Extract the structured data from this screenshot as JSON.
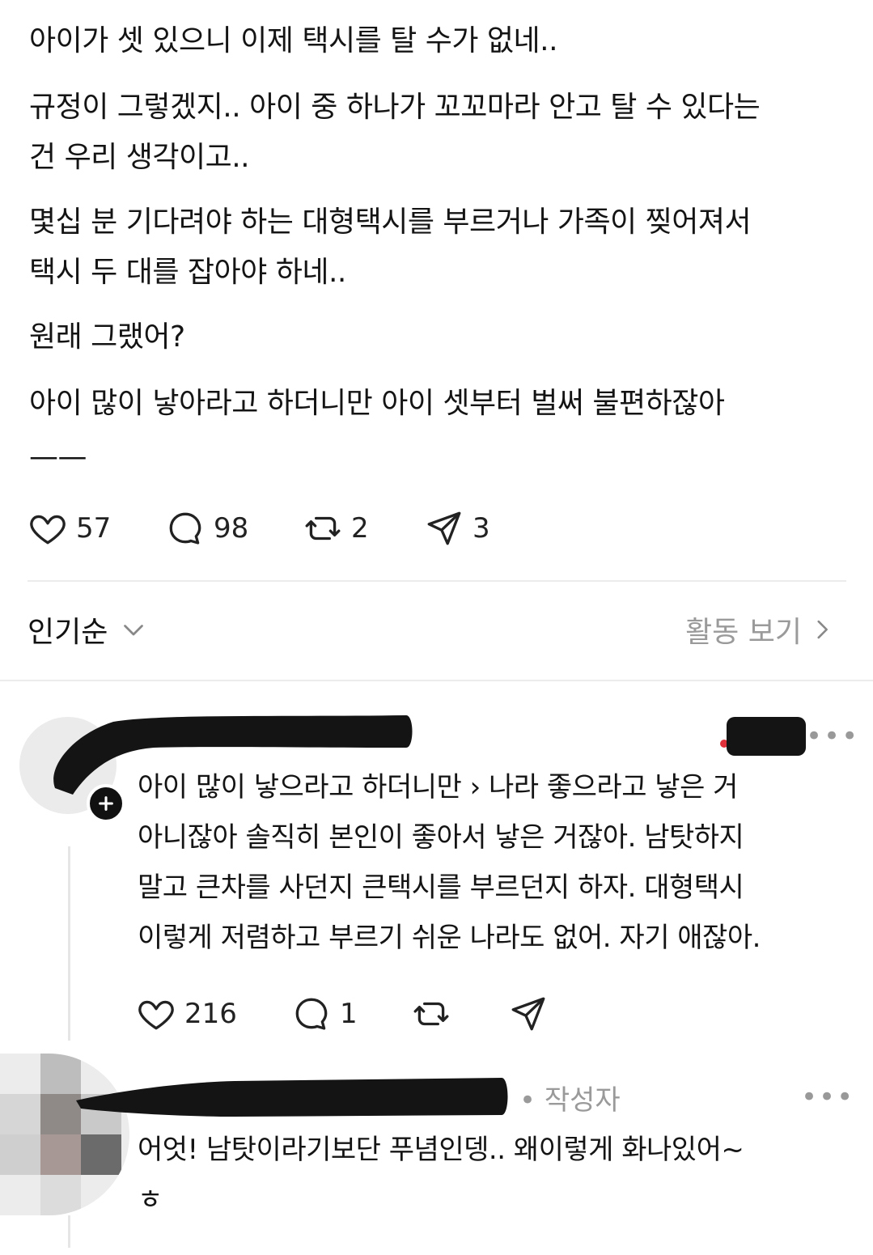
{
  "post": {
    "paragraphs": [
      [
        "아이가 셋 있으니 이제 택시를 탈 수가 없네.."
      ],
      [
        "규정이 그렇겠지.. 아이 중 하나가 꼬꼬마라 안고 탈 수 있다는",
        "건 우리 생각이고.."
      ],
      [
        "몇십 분 기다려야 하는 대형택시를 부르거나 가족이 찢어져서",
        "택시 두 대를 잡아야 하네.."
      ],
      [
        "원래 그랬어?"
      ],
      [
        "아이 많이 낳아라고 하더니만 아이 셋부터 벌써 불편하잖아"
      ],
      [
        "——"
      ]
    ],
    "actions": {
      "likes": "57",
      "comments": "98",
      "reposts": "2",
      "shares": "3"
    }
  },
  "sort": {
    "label": "인기순",
    "activity_label": "활동 보기"
  },
  "comments": [
    {
      "lines": [
        "아이 많이 낳으라고 하더니만 › 나라 좋으라고 낳은 거",
        "아니잖아 솔직히 본인이 좋아서 낳은 거잖아. 남탓하지",
        "말고 큰차를 사던지 큰택시를 부르던지 하자. 대형택시",
        "이렇게 저렴하고 부르기 쉬운 나라도 없어. 자기 애잖아."
      ],
      "likes": "216",
      "replies": "1",
      "more": "•••"
    },
    {
      "author_badge": "• 작성자",
      "lines": [
        "어엇! 남탓이라기보단 푸념인뎅.. 왜이렇게 화나있어~",
        "ㅎ"
      ],
      "more": "•••"
    }
  ],
  "colors": {
    "text": "#141414",
    "muted": "#9a9a9a",
    "divider": "#ececec",
    "redaction": "#141414"
  }
}
